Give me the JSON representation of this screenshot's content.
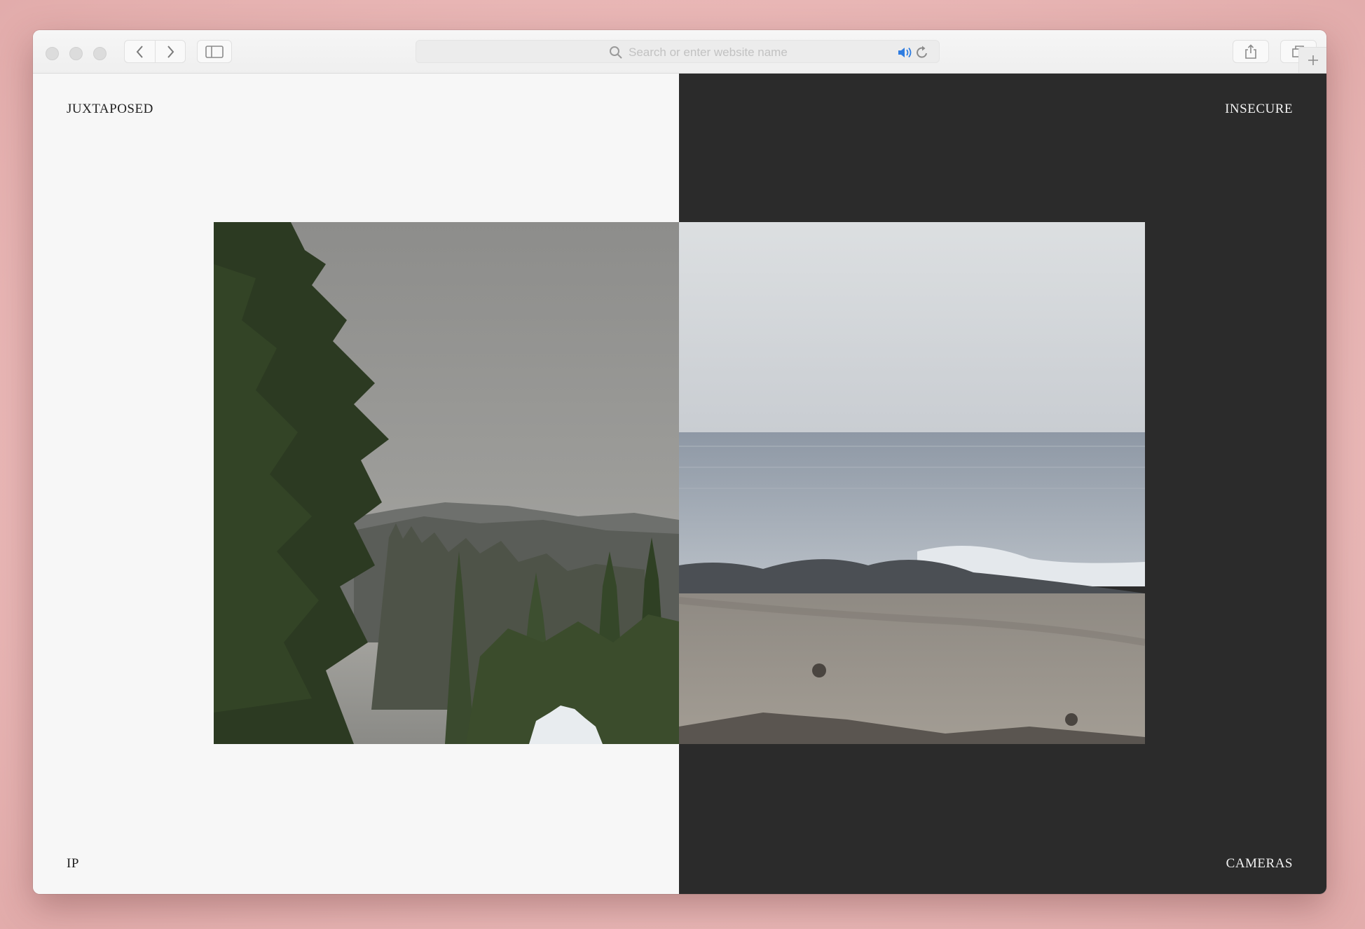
{
  "browser": {
    "address_placeholder": "Search or enter website name",
    "icons": [
      "close-light",
      "minimize-light",
      "zoom-light",
      "back-icon",
      "forward-icon",
      "sidebar-icon",
      "search-icon",
      "audio-icon",
      "reload-icon",
      "share-icon",
      "tabs-icon",
      "new-tab-icon"
    ]
  },
  "page": {
    "top_left": "JUXTAPOSED",
    "top_right": "INSECURE",
    "bottom_left": "IP",
    "bottom_right": "CAMERAS",
    "colors": {
      "left_bg": "#f7f7f7",
      "right_bg": "#2b2b2b"
    }
  },
  "images": {
    "left": "forest-mountain-fog-camera-feed",
    "right": "rocky-beach-ocean-camera-feed"
  }
}
